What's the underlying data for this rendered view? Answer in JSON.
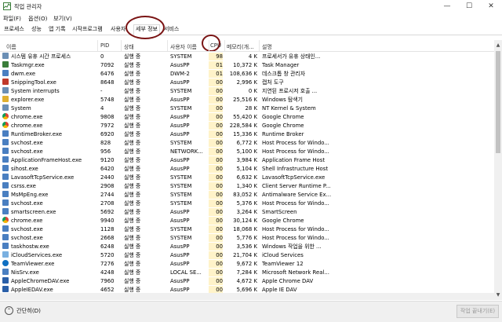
{
  "window": {
    "title": "작업 관리자",
    "minimize": "—",
    "maximize": "☐",
    "close": "✕"
  },
  "menu": [
    "파일(F)",
    "옵션(O)",
    "보기(V)"
  ],
  "tabs": [
    "프로세스",
    "성능",
    "앱 기록",
    "시작프로그램",
    "사용자",
    "세부 정보",
    "서비스"
  ],
  "active_tab": "세부 정보",
  "columns": [
    "이름",
    "PID",
    "상태",
    "사용자 이름",
    "CPU",
    "메모리(개...",
    "설명"
  ],
  "rows": [
    {
      "name": "시스템 유휴 시간 프로세스",
      "pid": "0",
      "status": "실행 중",
      "user": "SYSTEM",
      "cpu": "98",
      "mem": "4 K",
      "desc": "프로세서가 유휴 상태인...",
      "icon": "gear-icon",
      "color": "#6b8fb5"
    },
    {
      "name": "Taskmgr.exe",
      "pid": "7092",
      "status": "실행 중",
      "user": "AsusPP",
      "cpu": "01",
      "mem": "10,372 K",
      "desc": "Task Manager",
      "icon": "taskmgr-icon",
      "color": "#3a7d3a"
    },
    {
      "name": "dwm.exe",
      "pid": "6476",
      "status": "실행 중",
      "user": "DWM-2",
      "cpu": "01",
      "mem": "108,636 K",
      "desc": "데스크톱 창 관리자",
      "icon": "window-icon",
      "color": "#4a7fc1"
    },
    {
      "name": "SnippingTool.exe",
      "pid": "8648",
      "status": "실행 중",
      "user": "AsusPP",
      "cpu": "00",
      "mem": "2,996 K",
      "desc": "캡처 도구",
      "icon": "scissors-icon",
      "color": "#c0392b"
    },
    {
      "name": "System interrupts",
      "pid": "-",
      "status": "실행 중",
      "user": "SYSTEM",
      "cpu": "00",
      "mem": "0 K",
      "desc": "지연된 프로시저 호출 ...",
      "icon": "gear-icon",
      "color": "#6b8fb5"
    },
    {
      "name": "explorer.exe",
      "pid": "5748",
      "status": "실행 중",
      "user": "AsusPP",
      "cpu": "00",
      "mem": "25,516 K",
      "desc": "Windows 탐색기",
      "icon": "folder-icon",
      "color": "#e0b030"
    },
    {
      "name": "System",
      "pid": "4",
      "status": "실행 중",
      "user": "SYSTEM",
      "cpu": "00",
      "mem": "28 K",
      "desc": "NT Kernel & System",
      "icon": "gear-icon",
      "color": "#6b8fb5"
    },
    {
      "name": "chrome.exe",
      "pid": "9808",
      "status": "실행 중",
      "user": "AsusPP",
      "cpu": "00",
      "mem": "55,420 K",
      "desc": "Google Chrome",
      "icon": "chrome-icon",
      "color": "#db4437"
    },
    {
      "name": "chrome.exe",
      "pid": "7972",
      "status": "실행 중",
      "user": "AsusPP",
      "cpu": "00",
      "mem": "228,584 K",
      "desc": "Google Chrome",
      "icon": "chrome-icon",
      "color": "#db4437"
    },
    {
      "name": "RuntimeBroker.exe",
      "pid": "6920",
      "status": "실행 중",
      "user": "AsusPP",
      "cpu": "00",
      "mem": "15,336 K",
      "desc": "Runtime Broker",
      "icon": "window-icon",
      "color": "#4a7fc1"
    },
    {
      "name": "svchost.exe",
      "pid": "828",
      "status": "실행 중",
      "user": "SYSTEM",
      "cpu": "00",
      "mem": "6,772 K",
      "desc": "Host Process for Windo...",
      "icon": "window-icon",
      "color": "#4a7fc1"
    },
    {
      "name": "svchost.exe",
      "pid": "956",
      "status": "실행 중",
      "user": "NETWORK...",
      "cpu": "00",
      "mem": "5,100 K",
      "desc": "Host Process for Windo...",
      "icon": "window-icon",
      "color": "#4a7fc1"
    },
    {
      "name": "ApplicationFrameHost.exe",
      "pid": "9120",
      "status": "실행 중",
      "user": "AsusPP",
      "cpu": "00",
      "mem": "3,984 K",
      "desc": "Application Frame Host",
      "icon": "window-icon",
      "color": "#4a7fc1"
    },
    {
      "name": "sihost.exe",
      "pid": "6420",
      "status": "실행 중",
      "user": "AsusPP",
      "cpu": "00",
      "mem": "5,104 K",
      "desc": "Shell Infrastructure Host",
      "icon": "window-icon",
      "color": "#4a7fc1"
    },
    {
      "name": "LavasoftTcpService.exe",
      "pid": "2440",
      "status": "실행 중",
      "user": "SYSTEM",
      "cpu": "00",
      "mem": "6,632 K",
      "desc": "LavasoftTcpService.exe",
      "icon": "window-icon",
      "color": "#4a7fc1"
    },
    {
      "name": "csrss.exe",
      "pid": "2908",
      "status": "실행 중",
      "user": "SYSTEM",
      "cpu": "00",
      "mem": "1,340 K",
      "desc": "Client Server Runtime P...",
      "icon": "window-icon",
      "color": "#4a7fc1"
    },
    {
      "name": "MsMpEng.exe",
      "pid": "2744",
      "status": "실행 중",
      "user": "SYSTEM",
      "cpu": "00",
      "mem": "83,052 K",
      "desc": "Antimalware Service Ex...",
      "icon": "window-icon",
      "color": "#4a7fc1"
    },
    {
      "name": "svchost.exe",
      "pid": "2708",
      "status": "실행 중",
      "user": "SYSTEM",
      "cpu": "00",
      "mem": "5,376 K",
      "desc": "Host Process for Windo...",
      "icon": "window-icon",
      "color": "#4a7fc1"
    },
    {
      "name": "smartscreen.exe",
      "pid": "5692",
      "status": "실행 중",
      "user": "AsusPP",
      "cpu": "00",
      "mem": "3,264 K",
      "desc": "SmartScreen",
      "icon": "window-icon",
      "color": "#4a7fc1"
    },
    {
      "name": "chrome.exe",
      "pid": "9940",
      "status": "실행 중",
      "user": "AsusPP",
      "cpu": "00",
      "mem": "30,124 K",
      "desc": "Google Chrome",
      "icon": "chrome-icon",
      "color": "#db4437"
    },
    {
      "name": "svchost.exe",
      "pid": "1128",
      "status": "실행 중",
      "user": "SYSTEM",
      "cpu": "00",
      "mem": "18,068 K",
      "desc": "Host Process for Windo...",
      "icon": "window-icon",
      "color": "#4a7fc1"
    },
    {
      "name": "svchost.exe",
      "pid": "2668",
      "status": "실행 중",
      "user": "SYSTEM",
      "cpu": "00",
      "mem": "5,776 K",
      "desc": "Host Process for Windo...",
      "icon": "window-icon",
      "color": "#4a7fc1"
    },
    {
      "name": "taskhostw.exe",
      "pid": "6248",
      "status": "실행 중",
      "user": "AsusPP",
      "cpu": "00",
      "mem": "3,536 K",
      "desc": "Windows 작업을 위한 ...",
      "icon": "window-icon",
      "color": "#4a7fc1"
    },
    {
      "name": "iCloudServices.exe",
      "pid": "5720",
      "status": "실행 중",
      "user": "AsusPP",
      "cpu": "00",
      "mem": "21,704 K",
      "desc": "iCloud Services",
      "icon": "cloud-icon",
      "color": "#7ab0e0"
    },
    {
      "name": "TeamViewer.exe",
      "pid": "7276",
      "status": "실행 중",
      "user": "AsusPP",
      "cpu": "00",
      "mem": "9,672 K",
      "desc": "TeamViewer 12",
      "icon": "teamviewer-icon",
      "color": "#0e6fc2"
    },
    {
      "name": "NisSrv.exe",
      "pid": "4248",
      "status": "실행 중",
      "user": "LOCAL SE...",
      "cpu": "00",
      "mem": "7,284 K",
      "desc": "Microsoft Network Real...",
      "icon": "window-icon",
      "color": "#4a7fc1"
    },
    {
      "name": "AppleChromeDAV.exe",
      "pid": "7960",
      "status": "실행 중",
      "user": "AsusPP",
      "cpu": "00",
      "mem": "4,672 K",
      "desc": "Apple Chrome DAV",
      "icon": "apple-icon",
      "color": "#2a5fa8"
    },
    {
      "name": "AppleIEDAV.exe",
      "pid": "4652",
      "status": "실행 중",
      "user": "AsusPP",
      "cpu": "00",
      "mem": "5,696 K",
      "desc": "Apple IE DAV",
      "icon": "apple-icon",
      "color": "#2a5fa8"
    }
  ],
  "footer": {
    "fewer_details": "간단히(D)",
    "end_task": "작업 끝내기(E)"
  }
}
